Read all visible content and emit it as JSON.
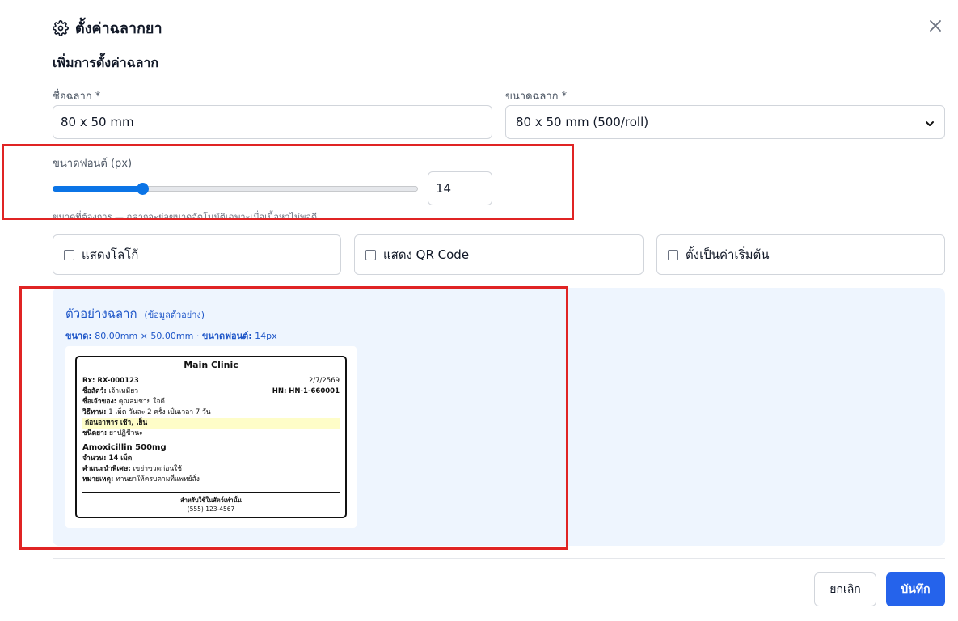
{
  "modal": {
    "title": "ตั้งค่าฉลากยา",
    "close_icon": "close-icon",
    "gear_icon": "gear-icon"
  },
  "form": {
    "section_title": "เพิ่มการตั้งค่าฉลาก",
    "label_name": {
      "label": "ชื่อฉลาก *",
      "value": "80 x 50 mm"
    },
    "label_size": {
      "label": "ขนาดฉลาก *",
      "value": "80 x 50 mm (500/roll)"
    },
    "font_size": {
      "label": "ขนาดฟอนต์ (px)",
      "value": "14",
      "slider_fraction": 0.245,
      "hint": "ขนาดที่ต้องการ — ฉลากจะย่อขนาดอัตโนมัติเฉพาะเมื่อเนื้อหาไม่พอดี"
    },
    "checkboxes": [
      {
        "label": "แสดงโลโก้",
        "checked": false
      },
      {
        "label": "แสดง QR Code",
        "checked": false
      },
      {
        "label": "ตั้งเป็นค่าเริ่มต้น",
        "checked": false
      }
    ]
  },
  "preview": {
    "title": "ตัวอย่างฉลาก",
    "subtitle": "(ข้อมูลตัวอย่าง)",
    "size_label": "ขนาด:",
    "size_value": "80.00mm × 50.00mm",
    "sep": "·",
    "font_label": "ขนาดฟอนต์:",
    "font_value": "14px",
    "label": {
      "clinic": "Main Clinic",
      "rx": "Rx: RX-000123",
      "date": "2/7/2569",
      "pet_label": "ชื่อสัตว์:",
      "pet_value": "เจ้าเหมียว",
      "hn": "HN: HN-1-660001",
      "owner_label": "ชื่อเจ้าของ:",
      "owner_value": "คุณสมชาย ใจดี",
      "usage_label": "วิธีทาน:",
      "usage_value": "1 เม็ด วันละ 2 ครั้ง เป็นเวลา 7 วัน",
      "timing": "ก่อนอาหาร เช้า, เย็น",
      "type_label": "ชนิดยา:",
      "type_value": "ยาปฏิชีวนะ",
      "drug": "Amoxicillin 500mg",
      "qty": "จำนวน: 14 เม็ด",
      "advice_label": "คำแนะนำพิเศษ:",
      "advice_value": "เขย่าขวดก่อนใช้",
      "note_label": "หมายเหตุ:",
      "note_value": "ทานยาให้ครบตามที่แพทย์สั่ง",
      "footer": "สำหรับใช้ในสัตว์เท่านั้น",
      "phone": "(555) 123-4567"
    }
  },
  "actions": {
    "cancel": "ยกเลิก",
    "save": "บันทึก"
  },
  "colors": {
    "primary": "#2563eb",
    "slider": "#0b74e6",
    "highlight_box": "#e02424",
    "preview_bg": "#eef5fe"
  }
}
